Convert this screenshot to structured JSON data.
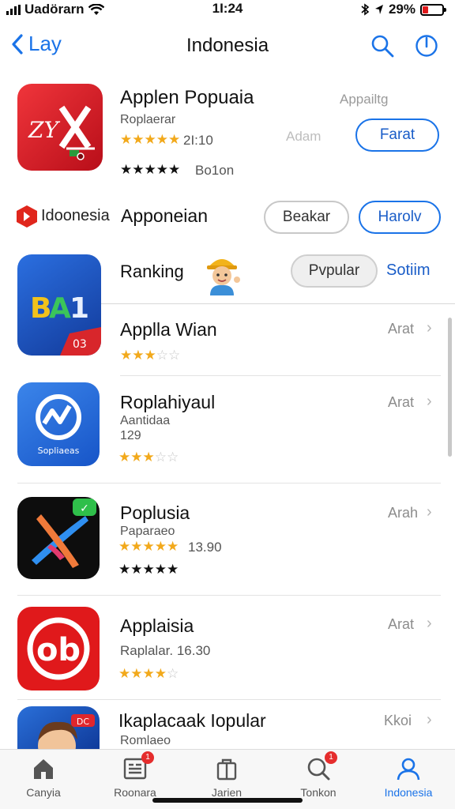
{
  "status_bar": {
    "carrier": "Uadörarn",
    "time": "1I:24",
    "battery": "29%",
    "battery_level": 0.29
  },
  "nav": {
    "back_label": "Lay",
    "title": "Indonesia"
  },
  "featured": {
    "name": "Applen Popuaia",
    "developer": "Roplaerar",
    "rating_text": "2I:10",
    "stars_filled": 5,
    "rating_count": "Bo1on",
    "faded_top": "Appailtg",
    "faded_mid": "Adam",
    "get_button": "Farat"
  },
  "brand_row": {
    "brand": "Idoonesia",
    "title": "Apponeian",
    "btn_left": "Beakar",
    "btn_right": "Harolv"
  },
  "ranking": {
    "label": "Ranking",
    "btn": "Pvpular",
    "link": "Sotiim"
  },
  "apps": [
    {
      "name": "Applla Wian",
      "stars": 3,
      "right": "Arat",
      "icon_badge": "03",
      "icon_text": "BA1"
    },
    {
      "name": "Roplahiyaul",
      "sub1": "Aantidaa",
      "sub2": "129",
      "stars": 3,
      "right": "Arat",
      "icon_text": "Sopliaeas"
    },
    {
      "name": "Poplusia",
      "sub1": "Paparaeo",
      "rating_text": "13.90",
      "stars": 5,
      "right": "Arah"
    },
    {
      "name": "Applaisia",
      "sub1": "Raplalar.  16.30",
      "stars": 4,
      "right": "Arat"
    },
    {
      "name": "Ikaplacaak Iopular",
      "sub1": "Romlaeo",
      "right": "Kkoi",
      "icon_badge": "DC"
    }
  ],
  "tabs": [
    {
      "label": "Canyia",
      "icon": "home-icon"
    },
    {
      "label": "Roonara",
      "icon": "news-icon",
      "badge": "1"
    },
    {
      "label": "Jarien",
      "icon": "bag-icon"
    },
    {
      "label": "Tonkon",
      "icon": "search-icon",
      "badge": "1"
    },
    {
      "label": "Indonesia",
      "icon": "profile-icon",
      "active": true
    }
  ],
  "colors": {
    "accent": "#1a73e8",
    "star": "#f2a91b",
    "badge": "#e52d2d"
  }
}
